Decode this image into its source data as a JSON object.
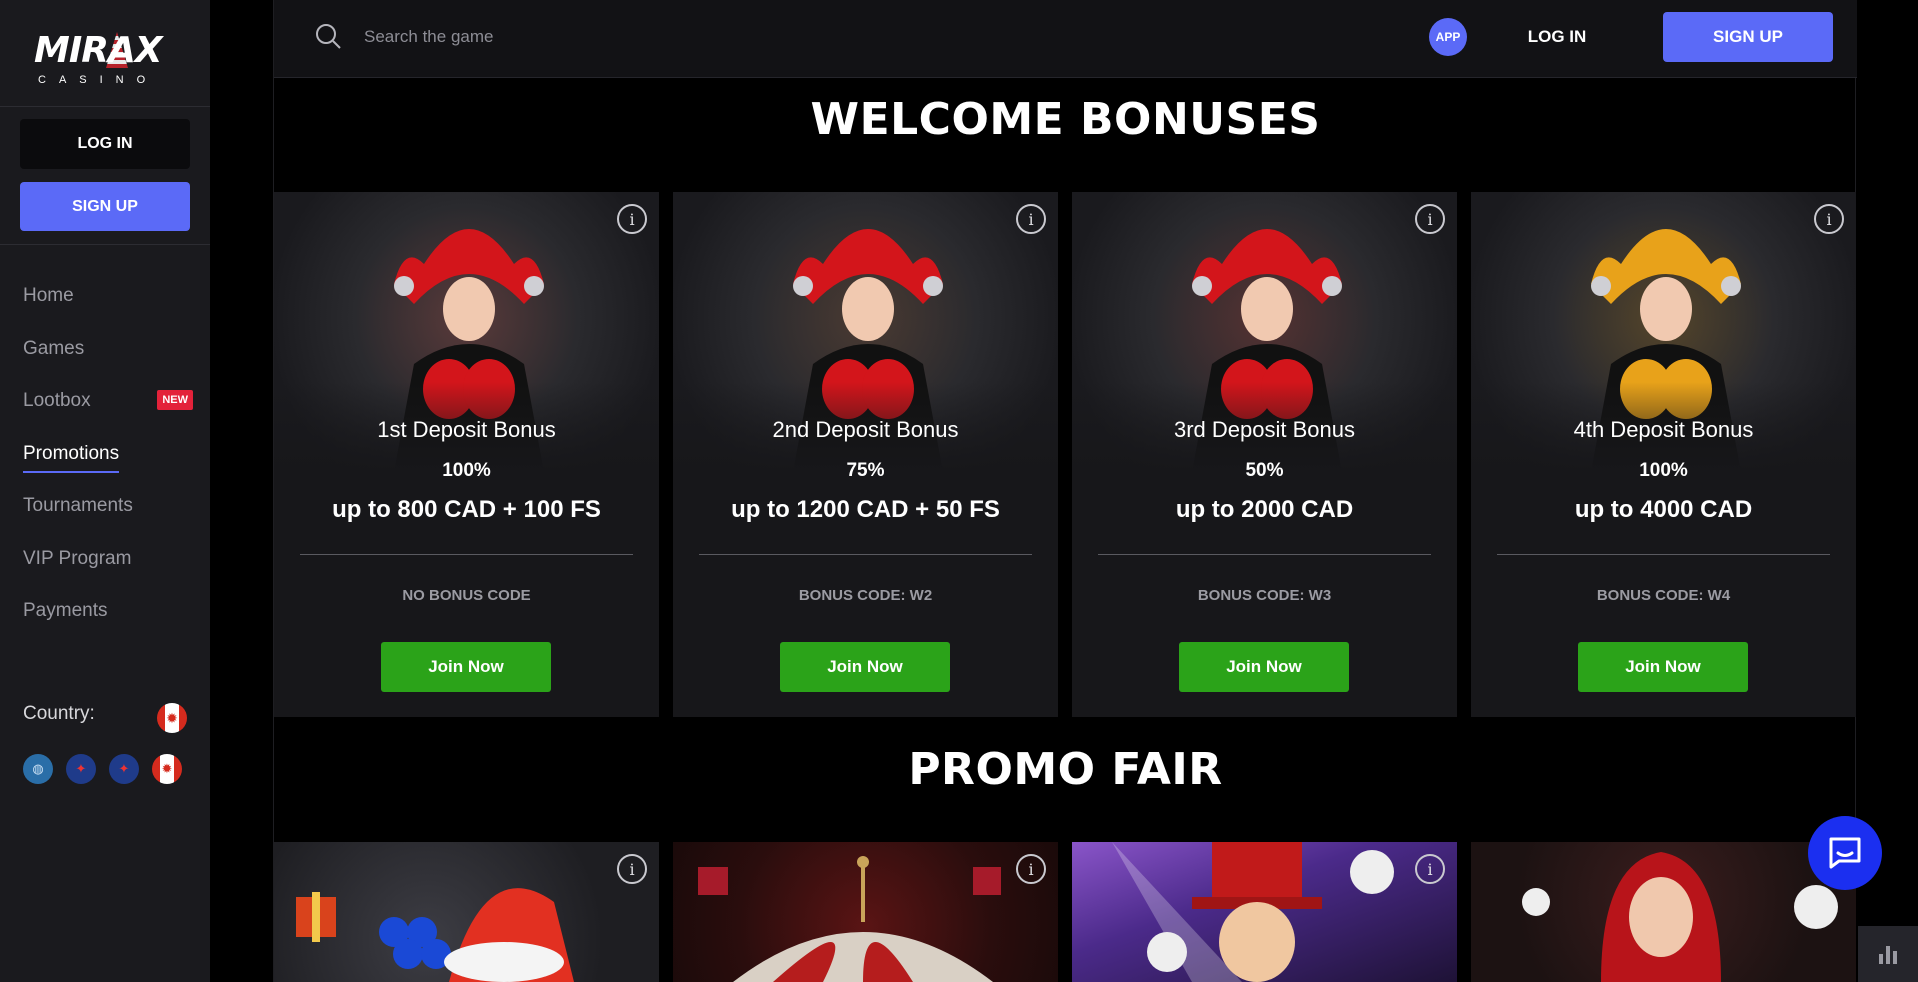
{
  "brand": {
    "name": "MIRAX",
    "sub": "CASINO"
  },
  "sidebar": {
    "login_label": "LOG IN",
    "signup_label": "SIGN UP",
    "items": [
      {
        "label": "Home"
      },
      {
        "label": "Games"
      },
      {
        "label": "Lootbox",
        "badge": "NEW"
      },
      {
        "label": "Promotions",
        "active": true
      },
      {
        "label": "Tournaments"
      },
      {
        "label": "VIP Program"
      },
      {
        "label": "Payments"
      }
    ],
    "country_label": "Country:"
  },
  "header": {
    "search_placeholder": "Search the game",
    "app_label": "APP",
    "login_label": "LOG IN",
    "signup_label": "SIGN UP"
  },
  "welcome": {
    "title": "WELCOME BONUSES",
    "cards": [
      {
        "title": "1st Deposit Bonus",
        "percent": "100%",
        "amount": "up to 800 CAD + 100 FS",
        "code": "NO BONUS CODE",
        "button": "Join Now"
      },
      {
        "title": "2nd Deposit Bonus",
        "percent": "75%",
        "amount": "up to 1200 CAD + 50 FS",
        "code": "BONUS CODE: W2",
        "button": "Join Now"
      },
      {
        "title": "3rd Deposit Bonus",
        "percent": "50%",
        "amount": "up to 2000 CAD",
        "code": "BONUS CODE: W3",
        "button": "Join Now"
      },
      {
        "title": "4th Deposit Bonus",
        "percent": "100%",
        "amount": "up to 4000 CAD",
        "code": "BONUS CODE: W4",
        "button": "Join Now"
      }
    ]
  },
  "promo_fair": {
    "title": "PROMO FAIR"
  },
  "colors": {
    "accent": "#5b6af7",
    "join": "#2ba319",
    "badge": "#e3223a",
    "chat": "#1b2ff0",
    "jester_red": "#d3151b",
    "jester_gold": "#e8a21a"
  }
}
